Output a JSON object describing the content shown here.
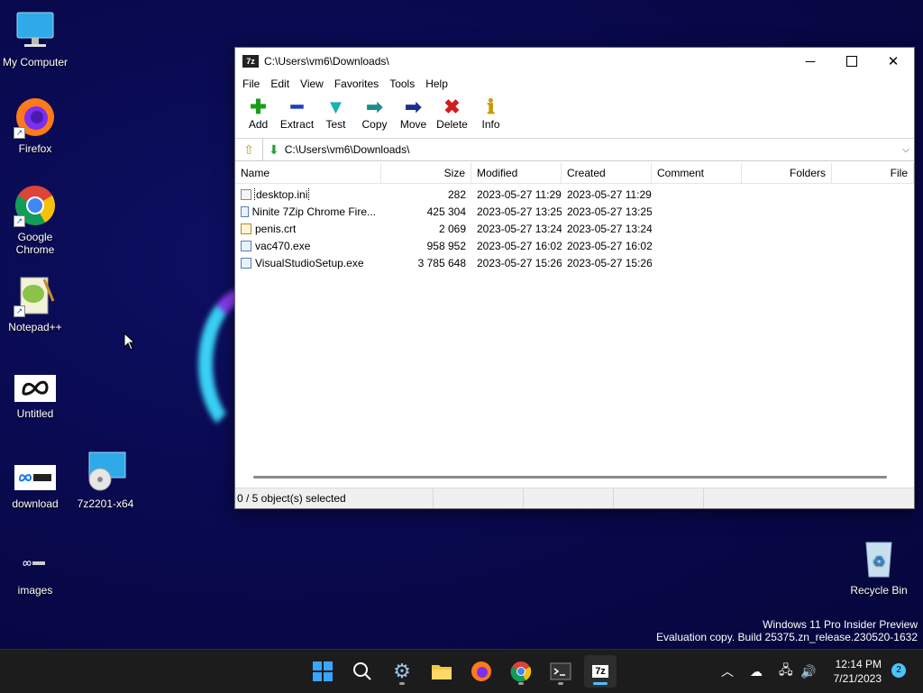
{
  "desktop": {
    "icons": [
      {
        "label": "My Computer"
      },
      {
        "label": "Firefox"
      },
      {
        "label": "Google Chrome"
      },
      {
        "label": "Notepad++"
      },
      {
        "label": "Untitled"
      },
      {
        "label": "download"
      },
      {
        "label": "7z2201-x64"
      },
      {
        "label": "images"
      },
      {
        "label": "Recycle Bin"
      }
    ]
  },
  "window": {
    "app_icon": "7z",
    "title": "C:\\Users\\vm6\\Downloads\\",
    "menu": [
      "File",
      "Edit",
      "View",
      "Favorites",
      "Tools",
      "Help"
    ],
    "toolbar": [
      {
        "label": "Add",
        "icon": "plus-icon",
        "color": "#1a9e1a"
      },
      {
        "label": "Extract",
        "icon": "minus-icon",
        "color": "#1a3fbf"
      },
      {
        "label": "Test",
        "icon": "check-icon",
        "color": "#17b3b3"
      },
      {
        "label": "Copy",
        "icon": "arrow-right-icon",
        "color": "#1c8c8c"
      },
      {
        "label": "Move",
        "icon": "arrow-right-icon",
        "color": "#1d2f8c"
      },
      {
        "label": "Delete",
        "icon": "x-icon",
        "color": "#d01c1c"
      },
      {
        "label": "Info",
        "icon": "info-icon",
        "color": "#c79a00"
      }
    ],
    "address": "C:\\Users\\vm6\\Downloads\\",
    "columns": [
      "Name",
      "Size",
      "Modified",
      "Created",
      "Comment",
      "Folders",
      "File"
    ],
    "files": [
      {
        "name": "desktop.ini",
        "size": "282",
        "modified": "2023-05-27 11:29",
        "created": "2023-05-27 11:29",
        "icon": "doc"
      },
      {
        "name": "Ninite 7Zip Chrome Fire...",
        "size": "425 304",
        "modified": "2023-05-27 13:25",
        "created": "2023-05-27 13:25",
        "icon": "exe"
      },
      {
        "name": "penis.crt",
        "size": "2 069",
        "modified": "2023-05-27 13:24",
        "created": "2023-05-27 13:24",
        "icon": "cert"
      },
      {
        "name": "vac470.exe",
        "size": "958 952",
        "modified": "2023-05-27 16:02",
        "created": "2023-05-27 16:02",
        "icon": "exe"
      },
      {
        "name": "VisualStudioSetup.exe",
        "size": "3 785 648",
        "modified": "2023-05-27 15:26",
        "created": "2023-05-27 15:26",
        "icon": "exe"
      }
    ],
    "status": "0 / 5 object(s) selected"
  },
  "watermark": {
    "line1": "Windows 11 Pro Insider Preview",
    "line2": "Evaluation copy. Build 25375.zn_release.230520-1632"
  },
  "taskbar": {
    "time": "12:14 PM",
    "date": "7/21/2023",
    "notifications": "2",
    "active_app": "7z"
  }
}
